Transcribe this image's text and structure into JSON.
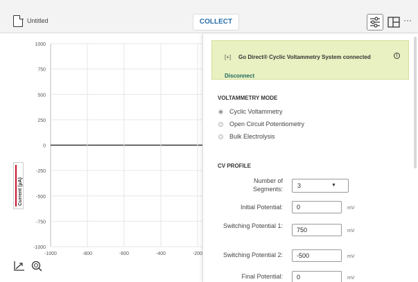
{
  "topbar": {
    "file_title": "Untitled",
    "collect_label": "COLLECT",
    "more_label": "···"
  },
  "graph": {
    "y_axis_label": "Current (µA)",
    "y_ticks": [
      "1000",
      "750",
      "500",
      "250",
      "0",
      "-250",
      "-500",
      "-750",
      "-1000"
    ],
    "x_ticks": [
      "-1000",
      "-800",
      "-600",
      "-400",
      "-200"
    ]
  },
  "panel": {
    "banner": {
      "plus": "[+]",
      "status_text": "Go Direct® Cyclic Voltammetry System connected",
      "info_icon": "ⓘ",
      "disconnect_label": "Disconnect",
      "background_color": "#e9f0c1"
    },
    "voltammetry_mode": {
      "title": "VOLTAMMETRY MODE",
      "options": [
        {
          "label": "Cyclic Voltammetry",
          "checked": true
        },
        {
          "label": "Open Circuit Potentiometry",
          "checked": false
        },
        {
          "label": "Bulk Electrolysis",
          "checked": false
        }
      ]
    },
    "cv_profile": {
      "title": "CV PROFILE",
      "segments_label": "Number of Segments:",
      "segments_value": "3",
      "initial_label": "Initial Potential:",
      "initial_value": "0",
      "switching1_label": "Switching Potential 1:",
      "switching1_value": "750",
      "switching2_label": "Switching Potential 2:",
      "switching2_value": "-500",
      "final_label": "Final Potential:",
      "final_value": "0",
      "unit": "mV"
    }
  },
  "colors": {
    "accent": "#2a6ea8",
    "current_marker": "#c8102e",
    "link": "#1d6a5f"
  }
}
